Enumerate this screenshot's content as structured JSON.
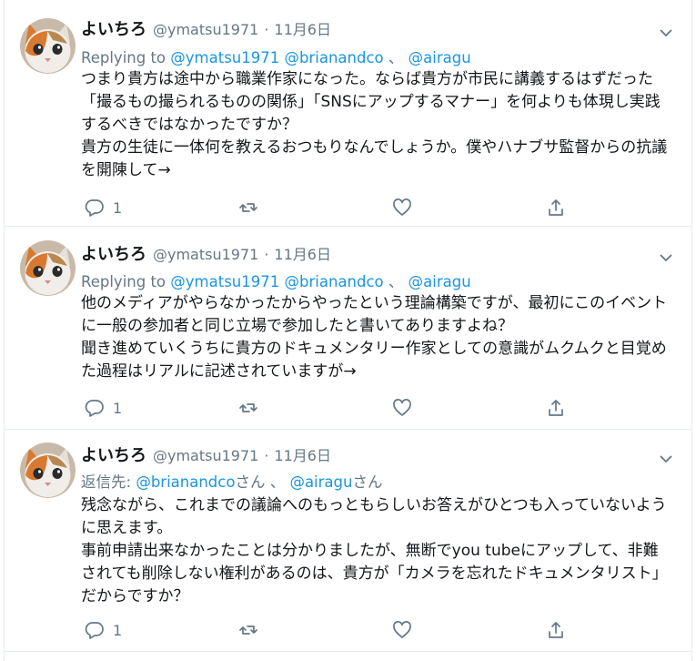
{
  "tweets": [
    {
      "name": "よいちろ",
      "handle": "@ymatsu1971",
      "separator": "·",
      "time": "11月6日",
      "reply_prefix": "Replying to",
      "reply_mention1": "@ymatsu1971",
      "reply_mention2": "@brianandco",
      "reply_sep": "、",
      "reply_mention3": "@airagu",
      "body": [
        "つまり貴方は途中から職業作家になった。ならば貴方が市民に講義するはずだった「撮るもの撮られるものの関係」「SNSにアップするマナー」を何よりも体現し実践するべきではなかったですか？",
        "貴方の生徒に一体何を教えるおつもりなんでしょうか。僕やハナブサ監督からの抗議を開陳して→"
      ],
      "reply_count": "1"
    },
    {
      "name": "よいちろ",
      "handle": "@ymatsu1971",
      "separator": "·",
      "time": "11月6日",
      "reply_prefix": "Replying to",
      "reply_mention1": "@ymatsu1971",
      "reply_mention2": "@brianandco",
      "reply_sep": "、",
      "reply_mention3": "@airagu",
      "body": [
        "他のメディアがやらなかったからやったという理論構築ですが、最初にこのイベントに一般の参加者と同じ立場で参加したと書いてありますよね？",
        "聞き進めていくうちに貴方のドキュメンタリー作家としての意識がムクムクと目覚めた過程はリアルに記述されていますが→"
      ],
      "reply_count": "1"
    },
    {
      "name": "よいちろ",
      "handle": "@ymatsu1971",
      "separator": "·",
      "time": "11月6日",
      "reply_prefix": "返信先:",
      "reply_mention1": "@brianandco",
      "reply_suffix1": "さん",
      "reply_sep": "、",
      "reply_mention2": "@airagu",
      "reply_suffix2": "さん",
      "body": [
        "残念ながら、これまでの議論へのもっともらしいお答えがひとつも入っていないように思えます。",
        "事前申請出来なかったことは分かりましたが、無断でyou tubeにアップして、非難されても削除しない権利があるのは、貴方が「カメラを忘れたドキュメンタリスト」だからですか？"
      ],
      "reply_count": "1"
    }
  ],
  "icons": {
    "reply": "reply-icon",
    "retweet": "retweet-icon",
    "like": "heart-icon",
    "share": "share-icon",
    "caret": "chevron-down-icon",
    "avatar": "cat-avatar"
  },
  "colors": {
    "link": "#1b95e0",
    "secondary_text": "#657786",
    "primary_text": "#14171a",
    "divider": "#e6ecf0"
  }
}
